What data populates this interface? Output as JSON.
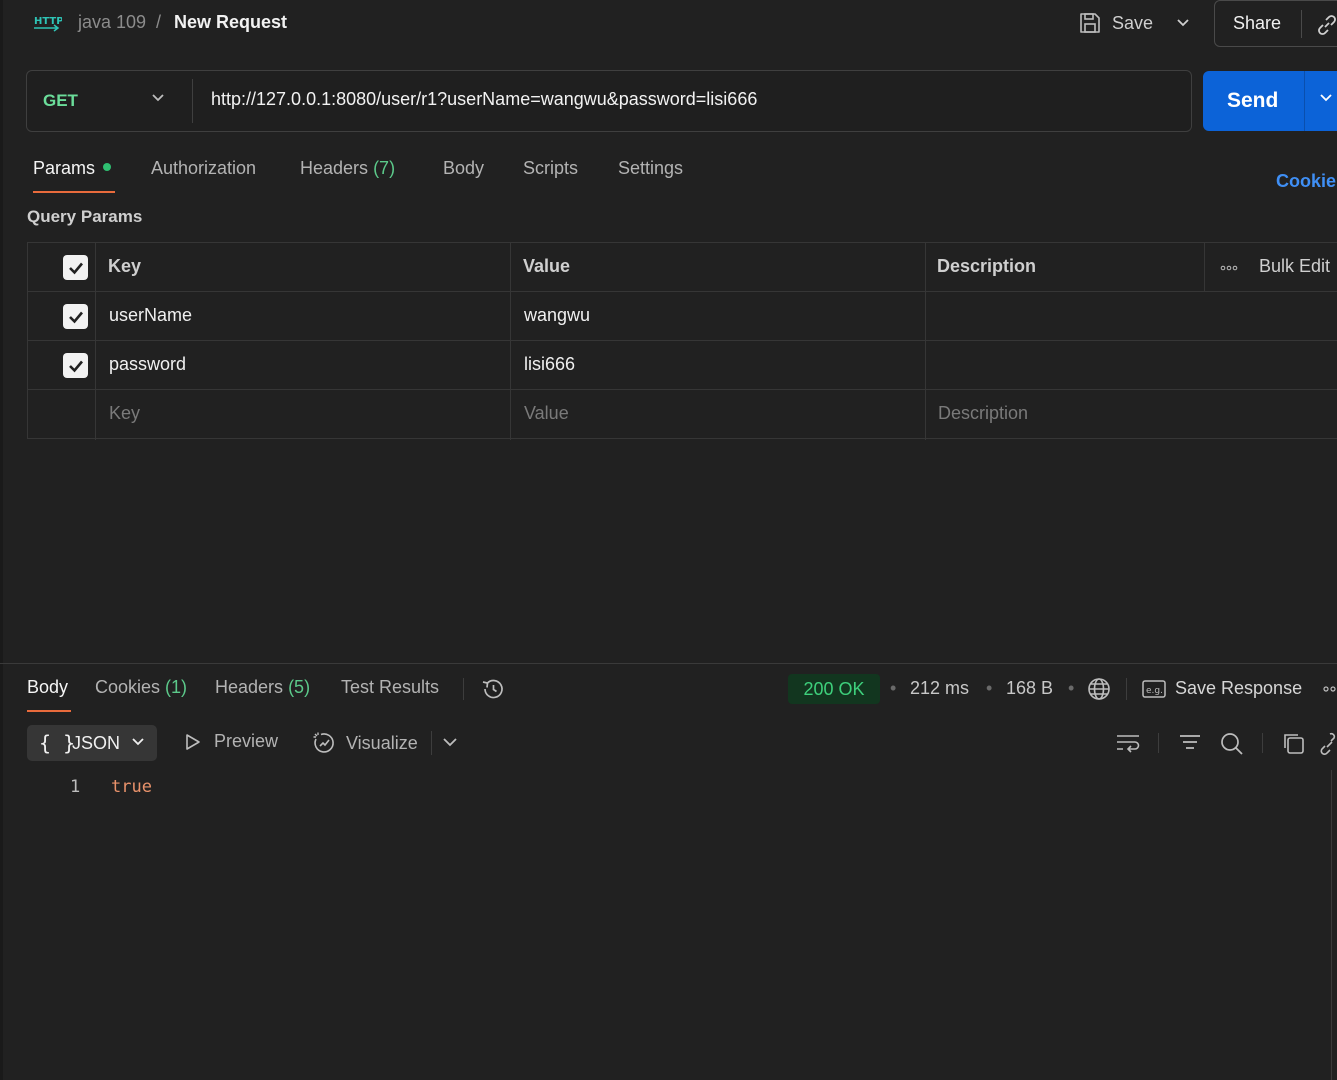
{
  "breadcrumb": {
    "collection": "java 109",
    "separator": "/",
    "title": "New Request"
  },
  "toolbar": {
    "save_label": "Save",
    "share_label": "Share"
  },
  "request": {
    "method": "GET",
    "url": "http://127.0.0.1:8080/user/r1?userName=wangwu&password=lisi666",
    "send_label": "Send"
  },
  "request_tabs": {
    "params": "Params",
    "authorization": "Authorization",
    "headers": "Headers",
    "headers_count": "(7)",
    "body": "Body",
    "scripts": "Scripts",
    "settings": "Settings",
    "cookies": "Cookie"
  },
  "params": {
    "section_title": "Query Params",
    "columns": {
      "key": "Key",
      "value": "Value",
      "description": "Description",
      "bulk_edit": "Bulk Edit"
    },
    "rows": [
      {
        "key": "userName",
        "value": "wangwu",
        "description": ""
      },
      {
        "key": "password",
        "value": "lisi666",
        "description": ""
      }
    ],
    "placeholder": {
      "key": "Key",
      "value": "Value",
      "description": "Description"
    }
  },
  "response_tabs": {
    "body": "Body",
    "cookies": "Cookies",
    "cookies_count": "(1)",
    "headers": "Headers",
    "headers_count": "(5)",
    "test_results": "Test Results"
  },
  "response_meta": {
    "status": "200 OK",
    "time": "212 ms",
    "size": "168 B",
    "save_response": "Save Response"
  },
  "response_view": {
    "format": "JSON",
    "format_braces": "{ }",
    "preview": "Preview",
    "visualize": "Visualize"
  },
  "response_body": {
    "line_number": "1",
    "content": "true"
  },
  "colors": {
    "background": "#212121",
    "accent_orange": "#e96b3c",
    "send_blue": "#0c63d8",
    "method_green": "#6bdd9a",
    "status_green": "#3ed07c",
    "link_blue": "#3f8ff5"
  },
  "icons": {
    "http": "http-icon",
    "save": "floppy-disk-icon",
    "caret": "chevron-down-icon",
    "link": "link-icon",
    "check": "check-icon",
    "more": "ellipsis-icon",
    "history": "history-icon",
    "globe": "globe-icon",
    "example": "example-icon",
    "preview": "play-icon",
    "visualize": "visualize-icon",
    "wrap": "wrap-lines-icon",
    "filter": "filter-icon",
    "search": "search-icon",
    "copy": "copy-icon"
  }
}
